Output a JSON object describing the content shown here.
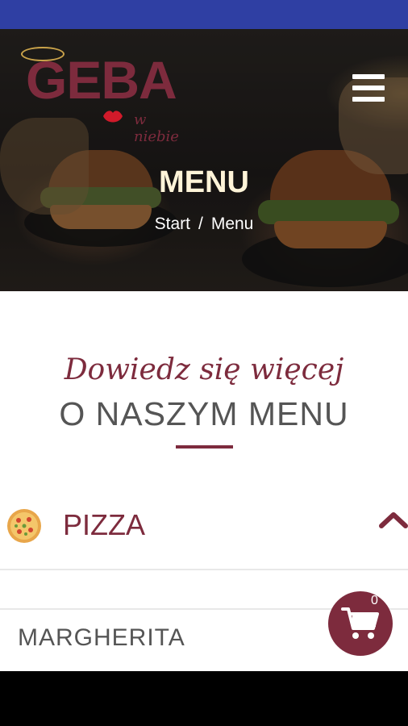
{
  "brand": {
    "logo_text": "GEBA",
    "logo_sub": "w niebie",
    "accent_color": "#7d2b3d",
    "status_bar_color": "#2f3fa3"
  },
  "header": {
    "menu_icon": "hamburger-icon"
  },
  "hero": {
    "title": "MENU",
    "breadcrumb": {
      "start": "Start",
      "separator": "/",
      "current": "Menu"
    }
  },
  "intro": {
    "script_text": "Dowiedz się więcej",
    "heading": "O NASZYM MENU"
  },
  "category": {
    "icon": "pizza-icon",
    "label": "PIZZA",
    "toggle_icon": "chevron-up-icon"
  },
  "items": [
    {
      "name": "MARGHERITA"
    }
  ],
  "cart": {
    "icon": "cart-icon",
    "count": "0"
  }
}
